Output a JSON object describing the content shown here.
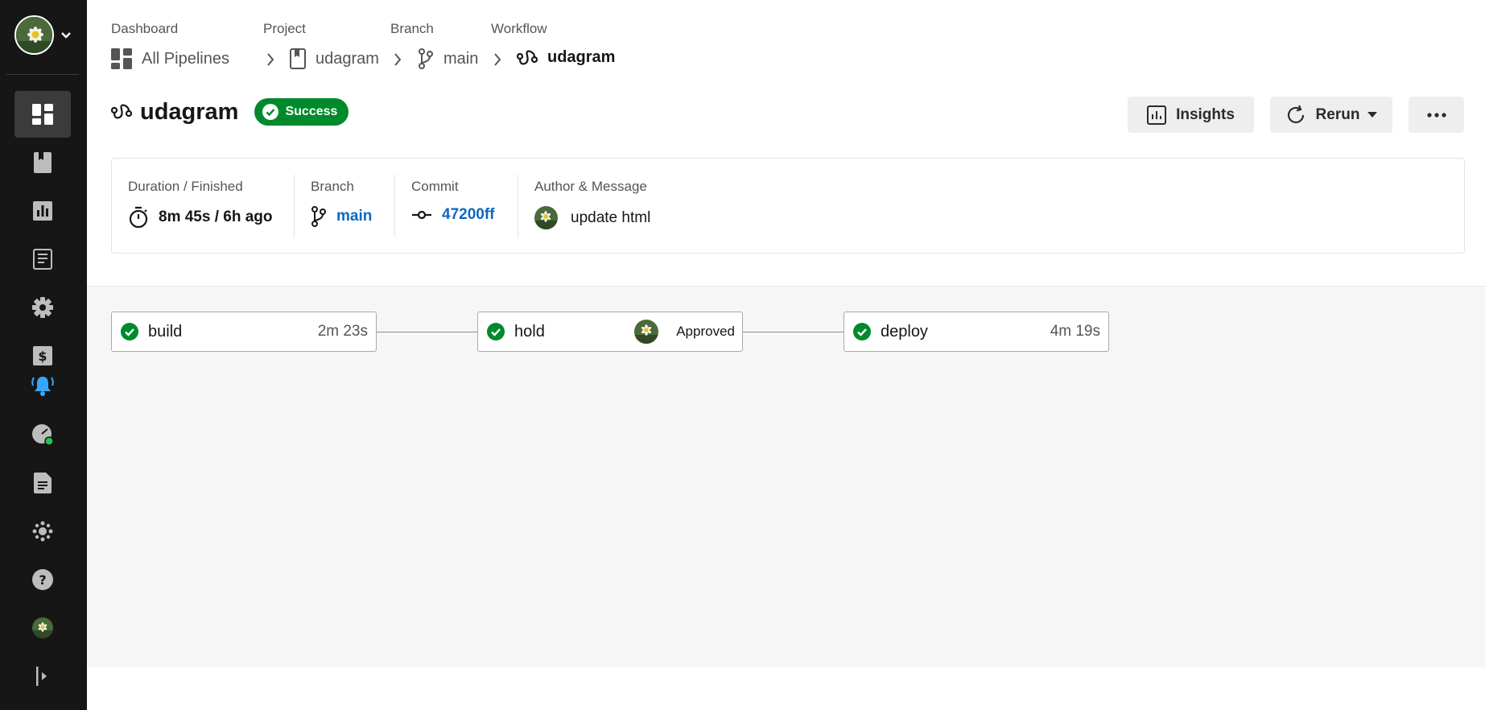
{
  "sidebar": {
    "items": [
      {
        "icon": "dashboard-icon",
        "active": true
      },
      {
        "icon": "projects-icon"
      },
      {
        "icon": "insights-icon"
      },
      {
        "icon": "deploys-icon"
      },
      {
        "icon": "settings-icon"
      },
      {
        "icon": "plan-icon"
      },
      {
        "icon": "notifications-icon"
      },
      {
        "icon": "status-icon"
      },
      {
        "icon": "docs-icon"
      },
      {
        "icon": "community-icon"
      },
      {
        "icon": "help-icon"
      },
      {
        "icon": "user-avatar"
      },
      {
        "icon": "collapse-icon"
      }
    ]
  },
  "breadcrumb": {
    "labels": [
      "Dashboard",
      "Project",
      "Branch",
      "Workflow"
    ],
    "items": [
      "All Pipelines",
      "udagram",
      "main",
      "udagram"
    ]
  },
  "header": {
    "title": "udagram",
    "status": "Success",
    "insights_label": "Insights",
    "rerun_label": "Rerun"
  },
  "meta": {
    "duration_label": "Duration / Finished",
    "duration_value": "8m 45s / 6h ago",
    "branch_label": "Branch",
    "branch_value": "main",
    "commit_label": "Commit",
    "commit_value": "47200ff",
    "author_label": "Author & Message",
    "message_value": "update html"
  },
  "jobs": [
    {
      "name": "build",
      "duration": "2m 23s",
      "status": "success"
    },
    {
      "name": "hold",
      "approval": "Approved",
      "status": "success"
    },
    {
      "name": "deploy",
      "duration": "4m 19s",
      "status": "success"
    }
  ],
  "colors": {
    "sidebar_bg": "#161616",
    "success": "#008a2c",
    "link": "#0f68c3",
    "button_bg": "#eeeeee",
    "graph_bg": "#f6f6f6"
  }
}
